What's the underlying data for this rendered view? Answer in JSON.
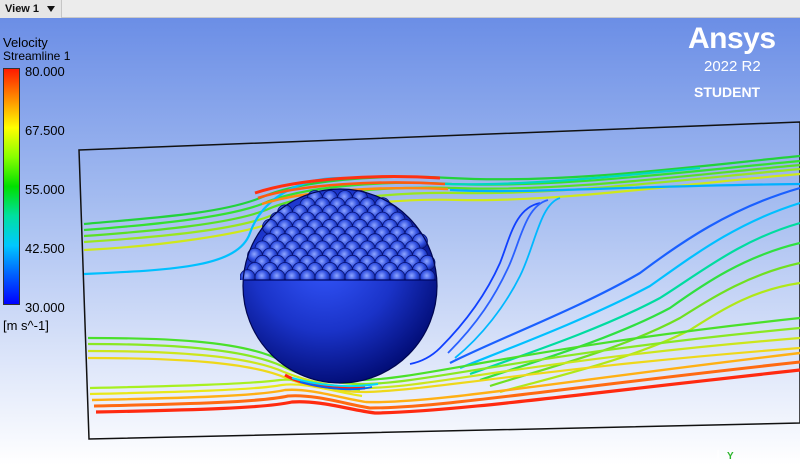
{
  "toolbar": {
    "view_label": "View 1"
  },
  "legend": {
    "variable": "Velocity",
    "object": "Streamline 1",
    "ticks": [
      "80.000",
      "67.500",
      "55.000",
      "42.500",
      "30.000"
    ],
    "units": "[m s^-1]",
    "color_stops": [
      "#ff1a00",
      "#ff8c00",
      "#ffff00",
      "#88ff00",
      "#00e000",
      "#00e0a0",
      "#00c8ff",
      "#0060ff",
      "#0000ff"
    ]
  },
  "branding": {
    "name": "Ansys",
    "version": "2022 R2",
    "edition": "STUDENT"
  },
  "triad": {
    "axis_label": "Y"
  },
  "colors": {
    "sphere": "#1830c8",
    "sphere_shadow": "#000a6e",
    "frame": "#111111"
  }
}
